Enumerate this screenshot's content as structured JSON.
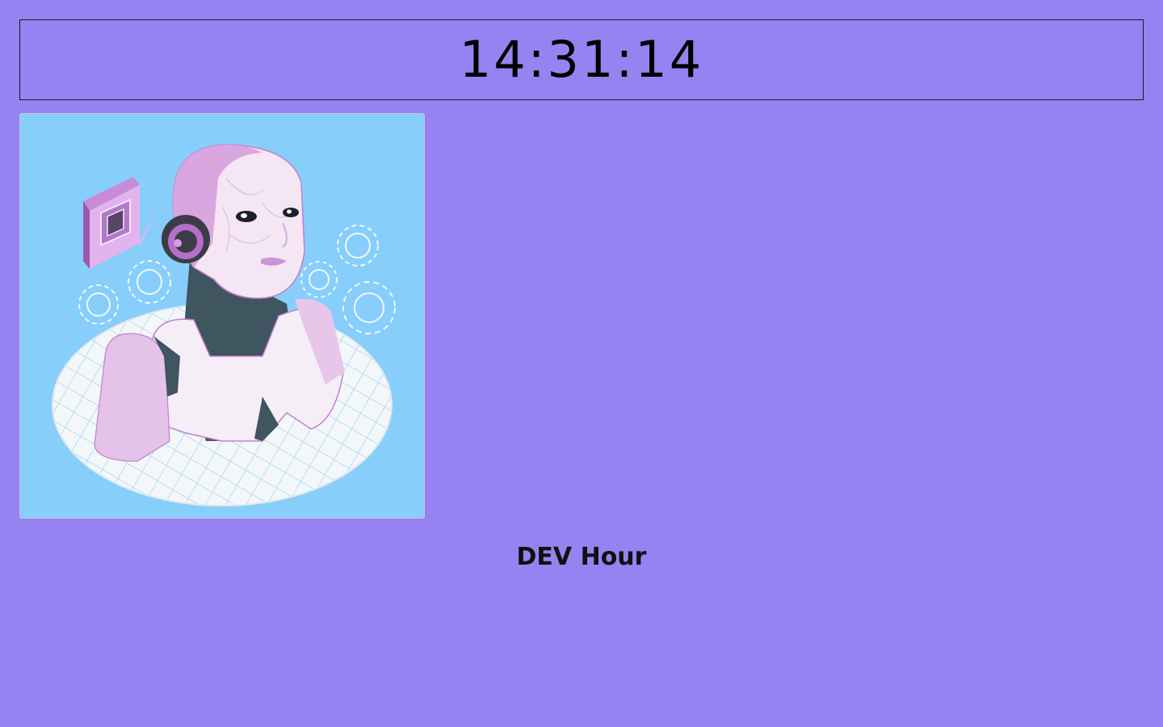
{
  "clock": {
    "time": "14:31:14"
  },
  "image": {
    "subject": "robot-illustration"
  },
  "caption": {
    "text": "DEV Hour"
  },
  "colors": {
    "background": "#9682f0",
    "image_background": "#87cefa",
    "robot_pink": "#e6c4ea",
    "robot_purple": "#b56fc9",
    "robot_dark": "#3f5560"
  }
}
